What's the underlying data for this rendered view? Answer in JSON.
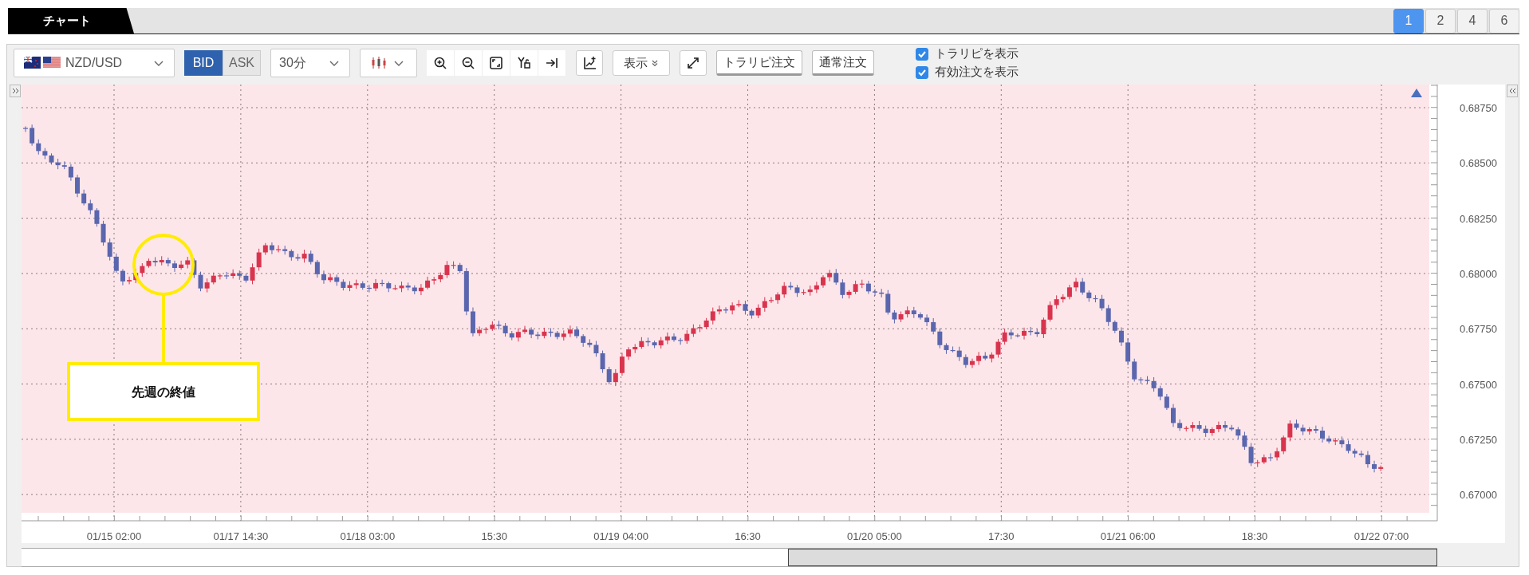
{
  "header_tab": {
    "label": "チャート"
  },
  "layout_buttons": [
    {
      "label": "1",
      "selected": true
    },
    {
      "label": "2",
      "selected": false
    },
    {
      "label": "4",
      "selected": false
    },
    {
      "label": "6",
      "selected": false
    }
  ],
  "toolbar": {
    "currency_pair": "NZD/USD",
    "price_type": [
      {
        "label": "BID",
        "selected": true
      },
      {
        "label": "ASK",
        "selected": false
      }
    ],
    "timeframe": "30分",
    "display_button": "表示",
    "order_buttons": [
      "トラリピ注文",
      "通常注文"
    ],
    "checkboxes": [
      {
        "label": "トラリピを表示",
        "checked": true
      },
      {
        "label": "有効注文を表示",
        "checked": true
      }
    ]
  },
  "chart": {
    "y_axis_labels": [
      "0.68750",
      "0.68500",
      "0.68250",
      "0.68000",
      "0.67750",
      "0.67500",
      "0.67250",
      "0.67000"
    ],
    "x_axis_labels": [
      "01/15 02:00",
      "01/17 14:30",
      "01/18 03:00",
      "15:30",
      "01/19 04:00",
      "16:30",
      "01/20 05:00",
      "17:30",
      "01/21 06:00",
      "18:30",
      "01/22 07:00"
    ],
    "annotation": "先週の終値"
  }
}
